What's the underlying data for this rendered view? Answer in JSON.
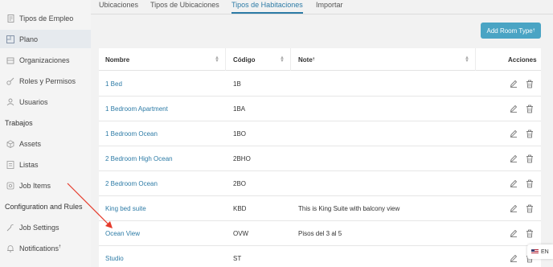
{
  "sidebar": {
    "items": [
      {
        "label": "Tipos de Empleo",
        "icon": "document-icon"
      },
      {
        "label": "Plano",
        "icon": "floorplan-icon"
      },
      {
        "label": "Organizaciones",
        "icon": "organization-icon"
      },
      {
        "label": "Roles y Permisos",
        "icon": "key-icon"
      },
      {
        "label": "Usuarios",
        "icon": "users-icon"
      }
    ],
    "section_trabajos": "Trabajos",
    "work_items": [
      {
        "label": "Assets",
        "icon": "cube-icon"
      },
      {
        "label": "Listas",
        "icon": "list-icon"
      },
      {
        "label": "Job Items",
        "icon": "hanger-icon"
      }
    ],
    "section_config": "Configuration and Rules",
    "config_items": [
      {
        "label": "Job Settings",
        "icon": "wrench-icon"
      },
      {
        "label": "Notifications",
        "icon": "bell-icon",
        "sup": "†"
      }
    ]
  },
  "tabs": [
    {
      "label": "Ubicaciones"
    },
    {
      "label": "Tipos de Ubicaciones"
    },
    {
      "label": "Tipos de Habitaciones",
      "active": true
    },
    {
      "label": "Importar"
    }
  ],
  "add_button": {
    "label": "Add Room Type",
    "sup": "†"
  },
  "table": {
    "headers": {
      "name": "Nombre",
      "code": "Código",
      "note": "Note",
      "note_sup": "†",
      "actions": "Acciones"
    },
    "rows": [
      {
        "name": "1 Bed",
        "code": "1B",
        "note": ""
      },
      {
        "name": "1 Bedroom Apartment",
        "code": "1BA",
        "note": ""
      },
      {
        "name": "1 Bedroom Ocean",
        "code": "1BO",
        "note": ""
      },
      {
        "name": "2 Bedroom High Ocean",
        "code": "2BHO",
        "note": ""
      },
      {
        "name": "2 Bedroom Ocean",
        "code": "2BO",
        "note": ""
      },
      {
        "name": "King bed suite",
        "code": "KBD",
        "note": "This is King Suite with balcony view"
      },
      {
        "name": "Ocean View",
        "code": "OVW",
        "note": "Pisos del 3 al 5"
      },
      {
        "name": "Studio",
        "code": "ST",
        "note": ""
      }
    ]
  },
  "language": {
    "label": "EN"
  },
  "colors": {
    "accent": "#2d7ba6",
    "button": "#4aa4c4",
    "annotation_arrow": "#e53b2c"
  }
}
